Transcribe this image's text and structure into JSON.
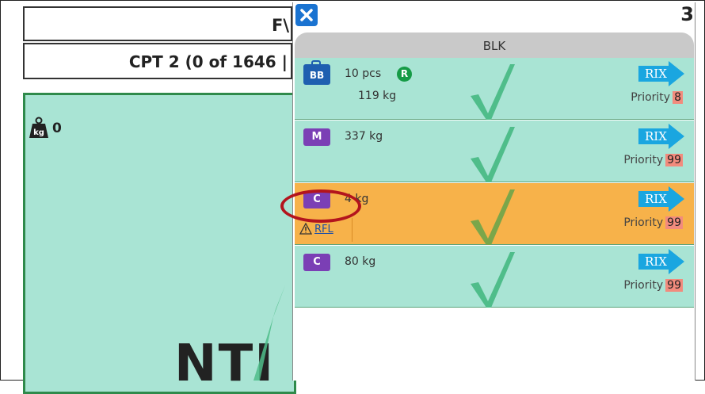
{
  "background": {
    "header_title": "F\\",
    "cpt_text": "CPT 2 (0 of 1646 |",
    "weight_value": "0",
    "weight_icon": "kg-weight-icon",
    "big_text": "NTI"
  },
  "popup": {
    "count": "3",
    "section": "BLK",
    "items": [
      {
        "tag": "BB",
        "line1": "10 pcs",
        "line2": "119 kg",
        "badge": "R",
        "dest": "RIX",
        "priority_label": "Priority",
        "priority": "8",
        "highlight": false
      },
      {
        "tag": "M",
        "line1": "337 kg",
        "dest": "RIX",
        "priority_label": "Priority",
        "priority": "99",
        "highlight": false
      },
      {
        "tag": "C",
        "line1": "4 kg",
        "dest": "RIX",
        "priority_label": "Priority",
        "priority": "99",
        "highlight": true,
        "warning": "RFL"
      },
      {
        "tag": "C",
        "line1": "80 kg",
        "dest": "RIX",
        "priority_label": "Priority",
        "priority": "99",
        "highlight": false
      }
    ]
  },
  "colors": {
    "item_green": "#a9e4d4",
    "item_highlight": "#f7b24a",
    "tag_purple": "#7b3fb5",
    "tag_blue": "#1f5fb0",
    "rix_arrow": "#1aa6e0",
    "priority_badge": "#f28b7d",
    "annotation_circle": "#b3141d"
  }
}
